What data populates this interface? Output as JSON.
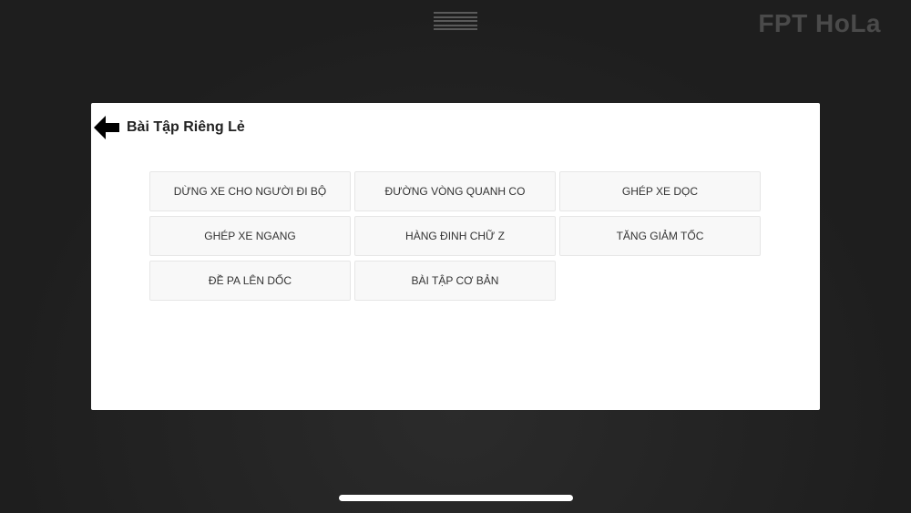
{
  "header": {
    "brand": "FPT HoLa"
  },
  "dialog": {
    "title": "Bài Tập Riêng Lẻ",
    "exercises": [
      {
        "label": "DỪNG XE CHO NGƯỜI ĐI BỘ"
      },
      {
        "label": "ĐƯỜNG VÒNG QUANH CO"
      },
      {
        "label": "GHÉP XE DỌC"
      },
      {
        "label": "GHÉP XE NGANG"
      },
      {
        "label": "HÀNG ĐINH CHỮ Z"
      },
      {
        "label": "TĂNG GIẢM TỐC"
      },
      {
        "label": "ĐỀ PA LÊN DỐC"
      },
      {
        "label": "BÀI TẬP CƠ BẢN"
      }
    ]
  },
  "icons": {
    "menu": "menu-icon",
    "back": "back-arrow-icon"
  },
  "colors": {
    "background": "#232323",
    "dialog": "#ffffff",
    "button": "#f8f8f8"
  }
}
